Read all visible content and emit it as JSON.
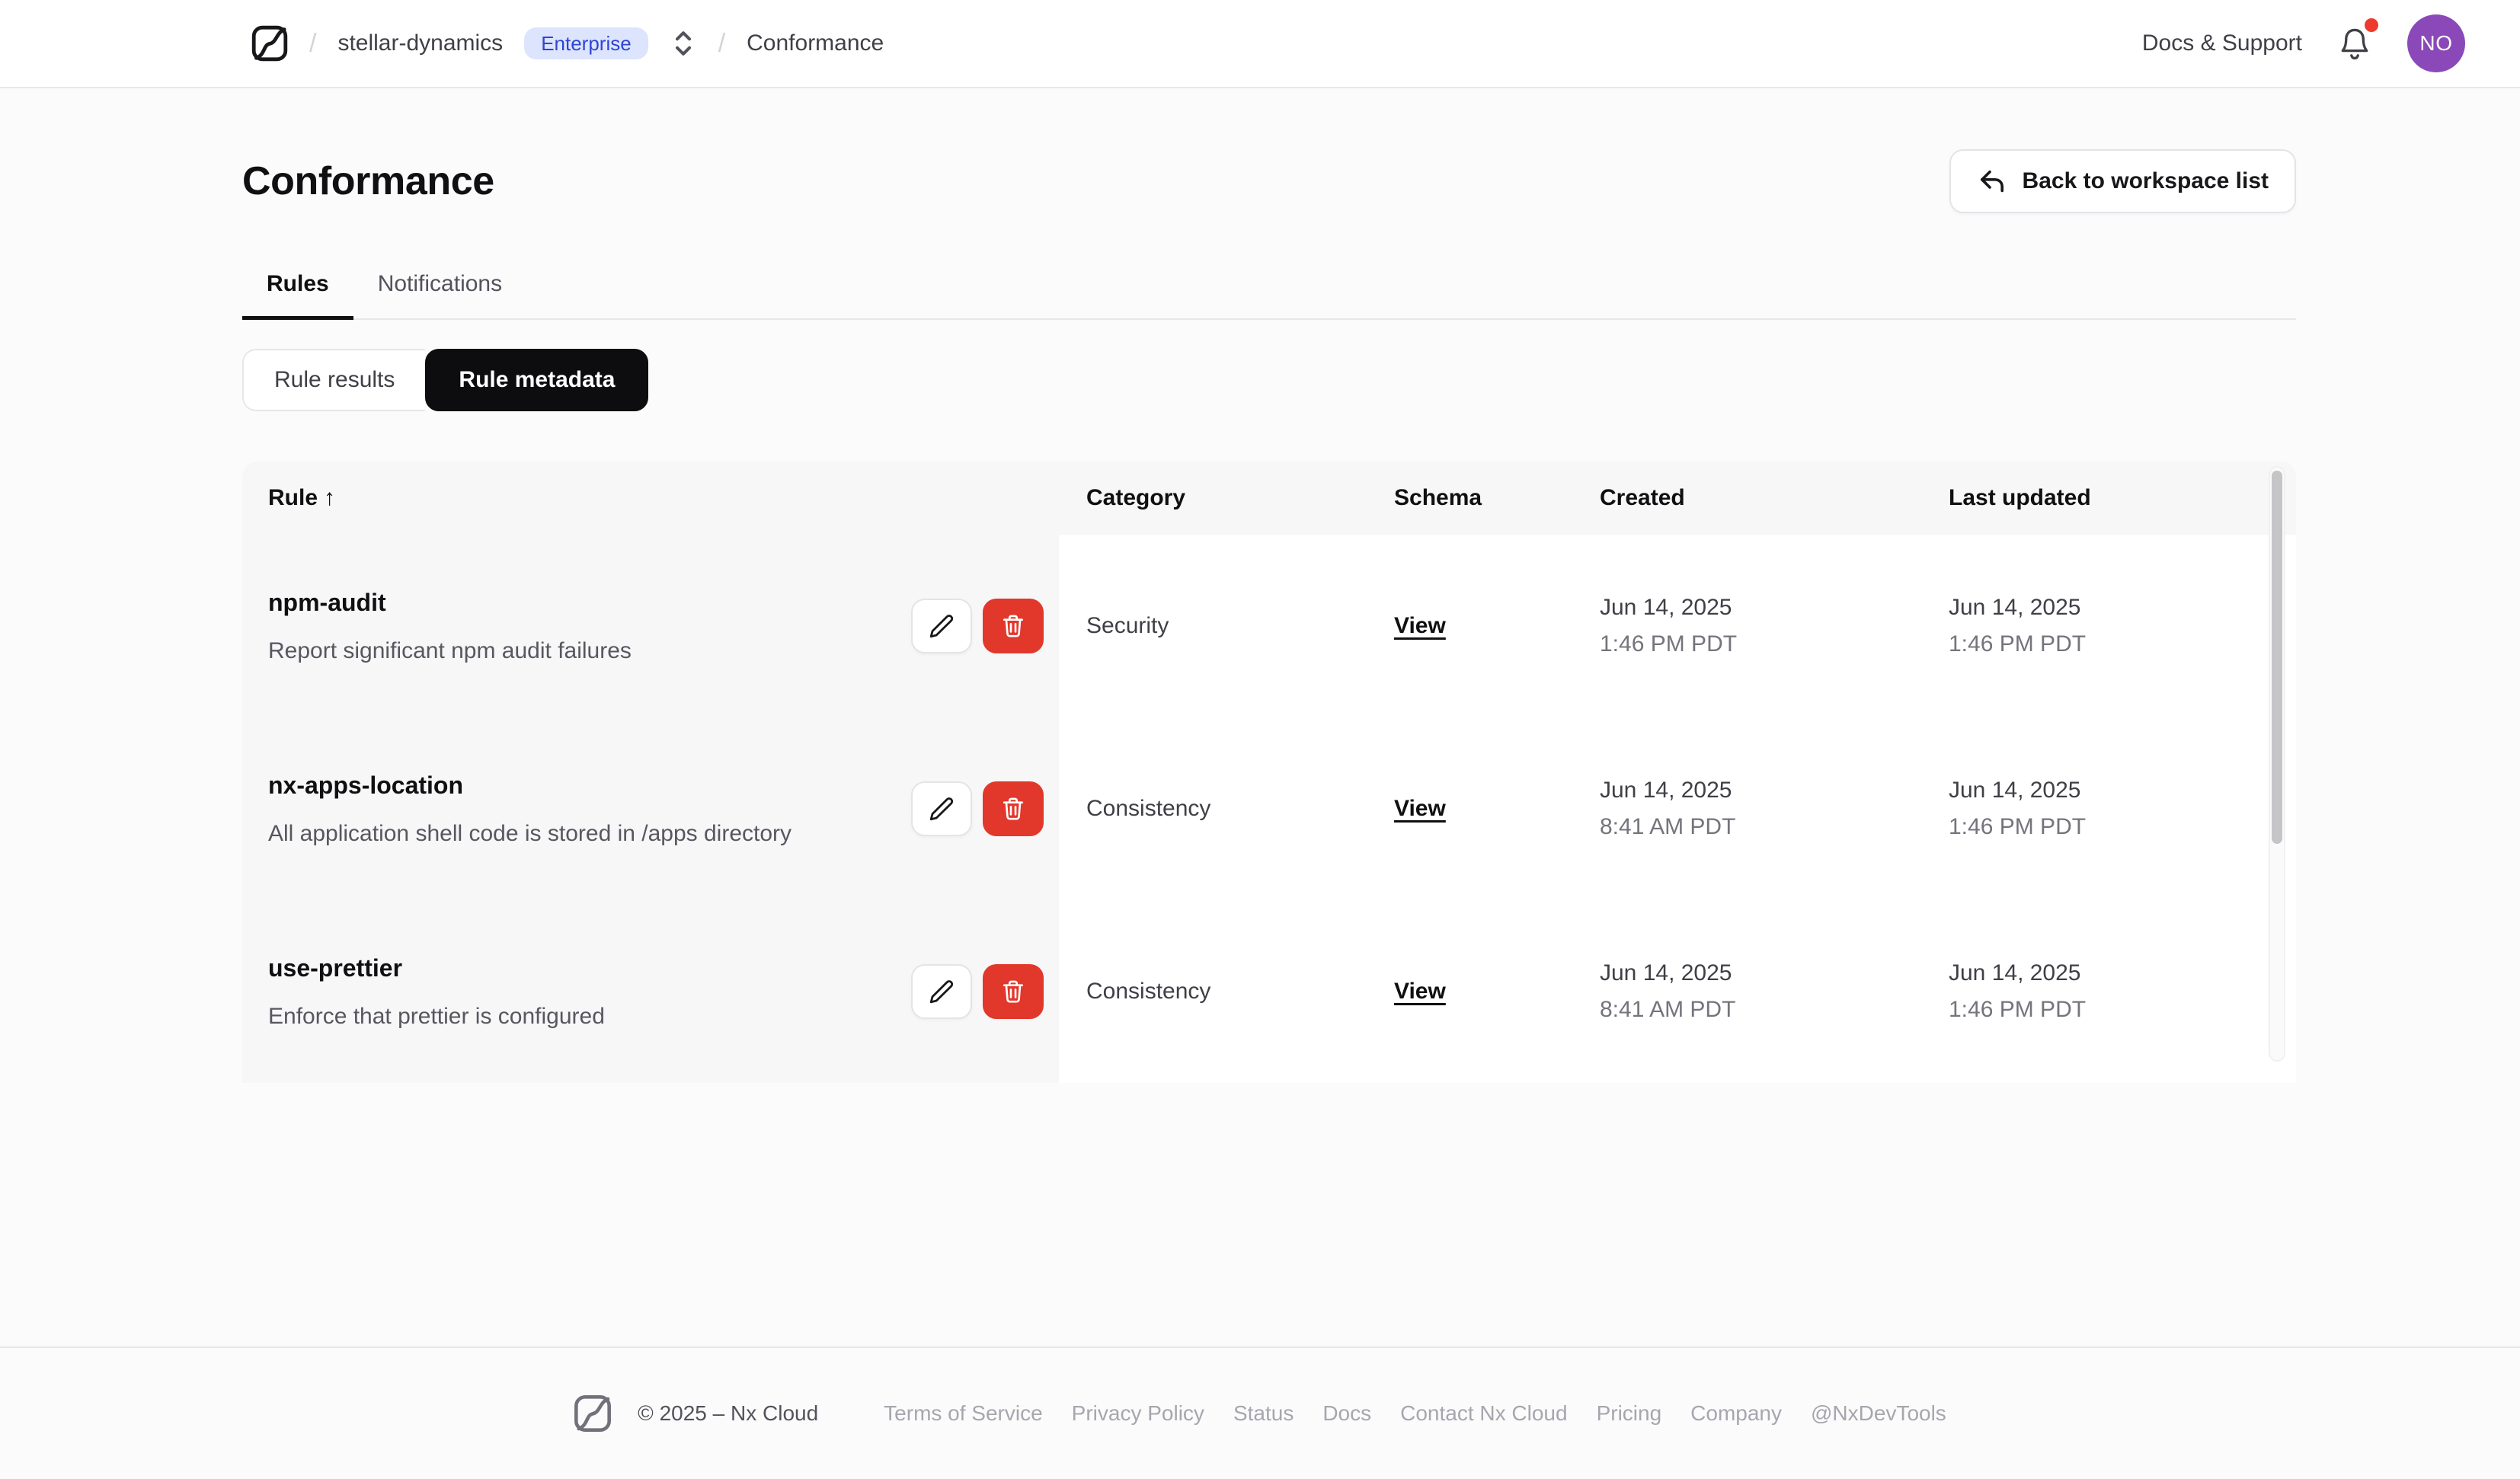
{
  "nav": {
    "separator": "/",
    "workspace": "stellar-dynamics",
    "badge": "Enterprise",
    "page": "Conformance",
    "docs_support": "Docs & Support",
    "avatar_initials": "NO"
  },
  "page": {
    "title": "Conformance",
    "back_button": "Back to workspace list"
  },
  "tabs": [
    {
      "label": "Rules",
      "active": true
    },
    {
      "label": "Notifications",
      "active": false
    }
  ],
  "segmented": [
    {
      "label": "Rule results",
      "active": false
    },
    {
      "label": "Rule metadata",
      "active": true
    }
  ],
  "table": {
    "columns": {
      "rule": "Rule",
      "category": "Category",
      "schema": "Schema",
      "created": "Created",
      "updated": "Last updated"
    },
    "sort_indicator": "↑",
    "rows": [
      {
        "name": "npm-audit",
        "description": "Report significant npm audit failures",
        "category": "Security",
        "schema_link": "View",
        "created_date": "Jun 14, 2025",
        "created_time": "1:46 PM PDT",
        "updated_date": "Jun 14, 2025",
        "updated_time": "1:46 PM PDT"
      },
      {
        "name": "nx-apps-location",
        "description": "All application shell code is stored in /apps directory",
        "category": "Consistency",
        "schema_link": "View",
        "created_date": "Jun 14, 2025",
        "created_time": "8:41 AM PDT",
        "updated_date": "Jun 14, 2025",
        "updated_time": "1:46 PM PDT"
      },
      {
        "name": "use-prettier",
        "description": "Enforce that prettier is configured",
        "category": "Consistency",
        "schema_link": "View",
        "created_date": "Jun 14, 2025",
        "created_time": "8:41 AM PDT",
        "updated_date": "Jun 14, 2025",
        "updated_time": "1:46 PM PDT"
      }
    ]
  },
  "footer": {
    "copyright": "© 2025 – Nx Cloud",
    "links": [
      "Terms of Service",
      "Privacy Policy",
      "Status",
      "Docs",
      "Contact Nx Cloud",
      "Pricing",
      "Company",
      "@NxDevTools"
    ]
  },
  "colors": {
    "badge_bg": "#dde4fd",
    "badge_text": "#2f45d4",
    "delete_red": "#e2382c",
    "avatar_purple": "#8b48b8",
    "notification_dot": "#ee3a2c",
    "active_segment_bg": "#0d0d0f"
  }
}
